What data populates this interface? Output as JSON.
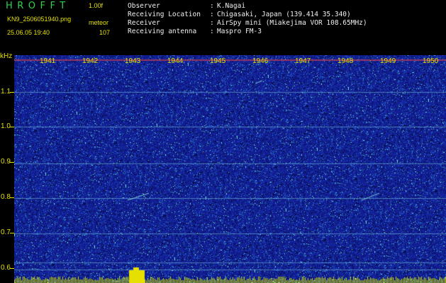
{
  "header": {
    "app_name": "HROFFT",
    "version": "1.00f",
    "file_name": "KN9_2506051940.png",
    "mode": "meteor",
    "date_time": "25.06.05 19:40",
    "count": "107"
  },
  "meta": [
    {
      "key": "Observer",
      "sep": ":",
      "value": "K.Nagai"
    },
    {
      "key": "Receiving Location",
      "sep": ":",
      "value": "Chigasaki, Japan (139.414 35.340)"
    },
    {
      "key": "Receiver",
      "sep": ":",
      "value": "AirSpy mini (Miakejima VOR 108.65MHz)"
    },
    {
      "key": "Receiving antenna",
      "sep": ":",
      "value": "Maspro FM-3"
    }
  ],
  "y_axis": {
    "unit": "kHz",
    "ticks": [
      "1.1",
      "1.0",
      "0.9",
      "0.8",
      "0.7",
      "0.6"
    ]
  },
  "time_marks": [
    "1941",
    "1942",
    "1943",
    "1944",
    "1945",
    "1946",
    "1947",
    "1948",
    "1949",
    "1950"
  ],
  "colors": {
    "background": "#000000",
    "plot_blue": "#1a2aa8",
    "label_yellow": "#e6e000",
    "title_green": "#2fd24a",
    "meta_white": "#f0f0f0"
  }
}
